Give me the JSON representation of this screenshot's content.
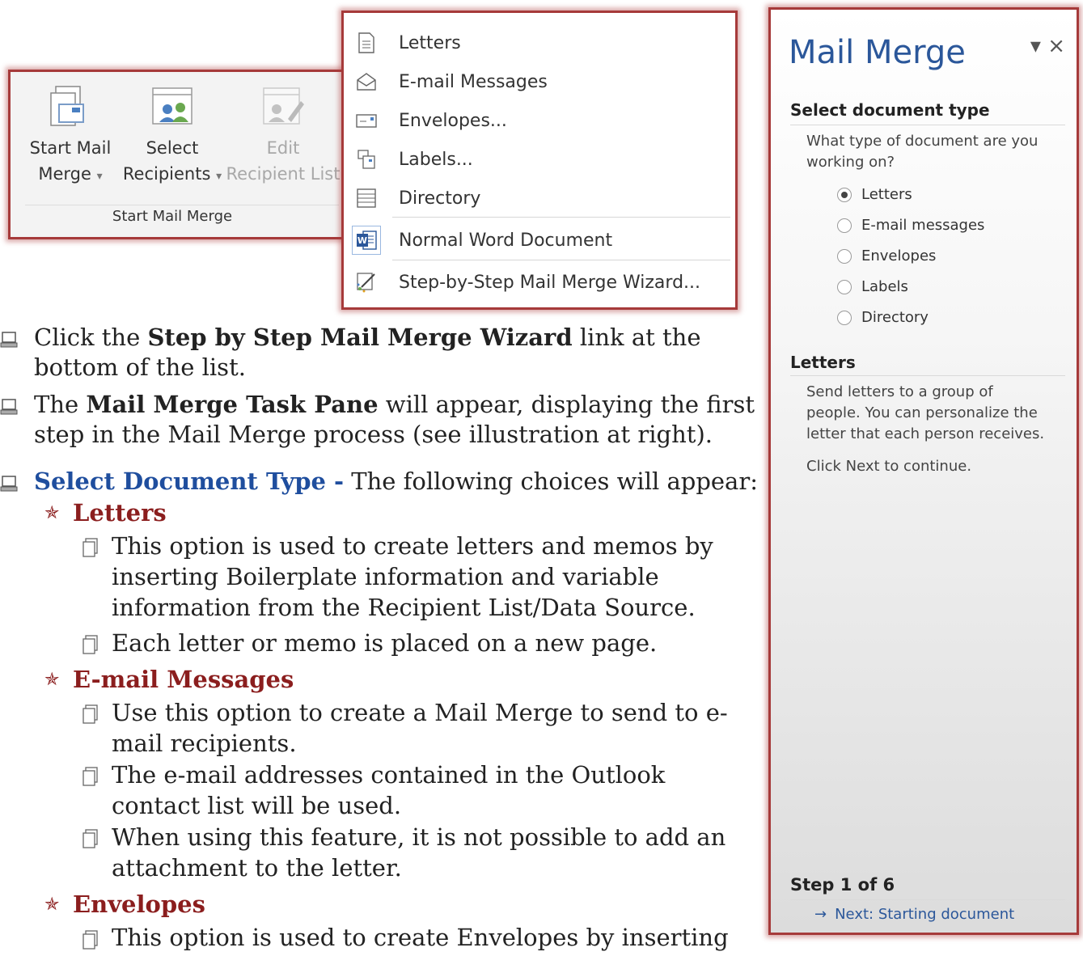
{
  "ribbon": {
    "start_mail_merge_1": "Start Mail",
    "start_mail_merge_2": "Merge",
    "select_recipients_1": "Select",
    "select_recipients_2": "Recipients",
    "edit_recipient_1": "Edit",
    "edit_recipient_2": "Recipient List",
    "dropdown_arrow": "▾",
    "group_label": "Start Mail Merge"
  },
  "menu": {
    "items": [
      {
        "label": "Letters",
        "icon": "document-icon"
      },
      {
        "label": "E-mail Messages",
        "icon": "envelope-open-icon"
      },
      {
        "label": "Envelopes...",
        "icon": "envelope-icon"
      },
      {
        "label": "Labels...",
        "icon": "labels-icon"
      },
      {
        "label": "Directory",
        "icon": "directory-icon"
      },
      {
        "label": "Normal Word Document",
        "icon": "word-icon"
      },
      {
        "label": "Step-by-Step Mail Merge Wizard...",
        "icon": "wizard-icon"
      }
    ]
  },
  "pane": {
    "title": "Mail Merge",
    "controls": "▾ ×",
    "section1": "Select document type",
    "question_1": "What type of document are you",
    "question_2": "working on?",
    "options": [
      "Letters",
      "E-mail messages",
      "Envelopes",
      "Labels",
      "Directory"
    ],
    "selected": "Letters",
    "section2": "Letters",
    "desc_1": "Send letters to a group of",
    "desc_2": "people. You can personalize the",
    "desc_3": "letter that each person receives.",
    "click_next": "Click Next to continue.",
    "step": "Step 1 of 6",
    "next_arrow": "→",
    "next_label": "Next: Starting document"
  },
  "doc": {
    "p1a_pre": "Click the ",
    "p1a_bold": "Step by Step Mail Merge Wizard",
    "p1a_post": " link at the",
    "p1b": "bottom of the list.",
    "p2a_pre": "The ",
    "p2a_bold": "Mail Merge Task Pane",
    "p2a_post": " will appear, displaying the first",
    "p2b": "step in the Mail Merge process (see illustration at right).",
    "p3_blue": "Select Document Type -",
    "p3_post": " The following choices will appear:",
    "h_letters": "Letters",
    "l1a": "This option is used to create letters and memos by",
    "l1b": "inserting Boilerplate information and variable",
    "l1c": "information from the Recipient List/Data Source.",
    "l2": "Each letter or memo is placed on a new page.",
    "h_email": "E-mail Messages",
    "e1a": "Use this option to create a Mail Merge to send to e-",
    "e1b": "mail recipients.",
    "e2a": "The e-mail addresses contained in the Outlook",
    "e2b": "contact list will be used.",
    "e3a": "When using this feature, it is not possible to add an",
    "e3b": "attachment to the letter.",
    "h_envelopes": "Envelopes",
    "last_line": "This option is used to create Envelopes by inserting"
  }
}
